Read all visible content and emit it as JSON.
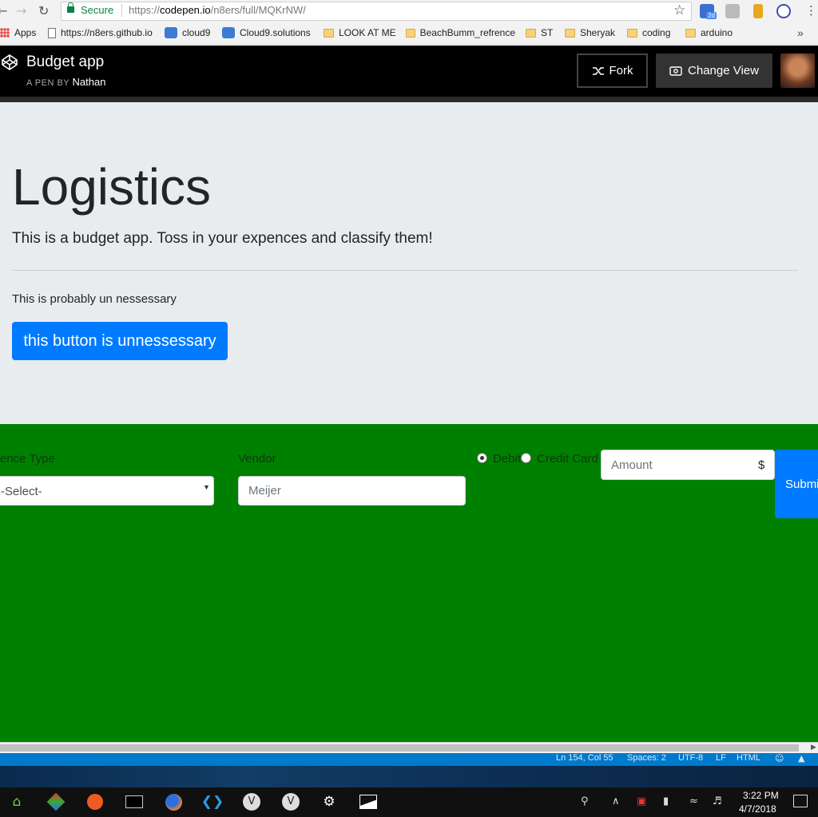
{
  "browser": {
    "secure_label": "Secure",
    "url_scheme": "https://",
    "url_domain": "codepen.io",
    "url_path": "/n8ers/full/MQKrNW/",
    "ext_badge": "2d"
  },
  "bookmarks": [
    {
      "label": "Apps",
      "icon": "apps-icon"
    },
    {
      "label": "https://n8ers.github.io",
      "icon": "page-icon"
    },
    {
      "label": "cloud9",
      "icon": "cloud9-icon"
    },
    {
      "label": "Cloud9.solutions",
      "icon": "cloud9-icon"
    },
    {
      "label": "LOOK AT ME",
      "icon": "folder-icon"
    },
    {
      "label": "BeachBumm_refrence",
      "icon": "folder-icon"
    },
    {
      "label": "ST",
      "icon": "folder-icon"
    },
    {
      "label": "Sheryak",
      "icon": "folder-icon"
    },
    {
      "label": "coding",
      "icon": "folder-icon"
    },
    {
      "label": "arduino",
      "icon": "folder-icon"
    }
  ],
  "codepen": {
    "title": "Budget app",
    "by_label": "A PEN BY",
    "author": "Nathan",
    "fork_label": "Fork",
    "change_view_label": "Change View"
  },
  "jumbotron": {
    "title": "Logistics",
    "lead": "This is a budget app. Toss in your expences and classify them!",
    "note": "This is probably un nessessary",
    "button_label": "this button is unnessessary"
  },
  "form": {
    "type_label": "Expence Type",
    "type_selected": "-Select-",
    "vendor_label": "Vendor",
    "vendor_placeholder": "Meijer",
    "debit_label": "Debit",
    "credit_label": "Credit Card",
    "debit_checked": true,
    "amount_placeholder": "Amount",
    "amount_suffix": "$",
    "submit_label": "Submit"
  },
  "editor_status": {
    "position": "Ln 154, Col 55",
    "spaces": "Spaces: 2",
    "encoding": "UTF-8",
    "eol": "LF",
    "language": "HTML"
  },
  "taskbar": {
    "time": "3:22 PM",
    "date": "4/7/2018"
  },
  "colors": {
    "accent": "#007bff",
    "form_background": "#008000",
    "jumbotron_background": "#e9ecef",
    "header_background": "#000000"
  }
}
